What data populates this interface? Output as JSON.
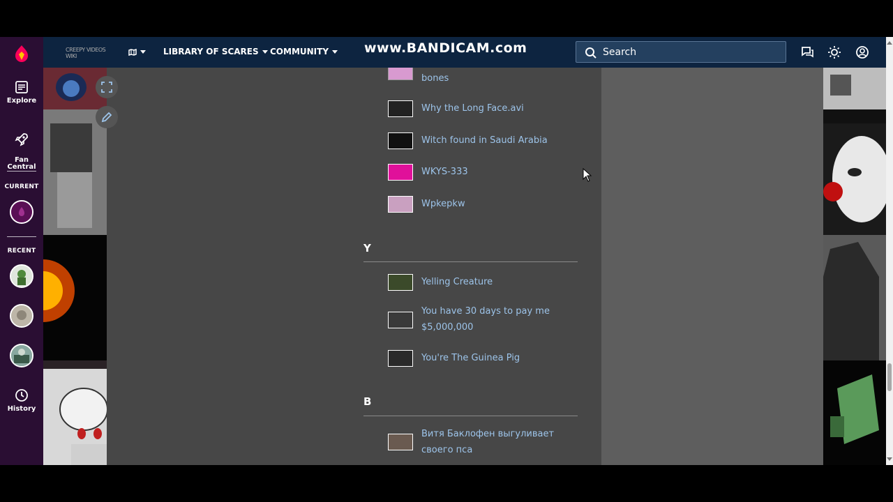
{
  "rail": {
    "explore": "Explore",
    "fan_central": "Fan\nCentral",
    "current": "CURRENT",
    "recent": "RECENT",
    "history": "History"
  },
  "nav": {
    "wiki_logo_text": "CREEPY VIDEOS WIKI",
    "library": "LIBRARY OF SCARES",
    "community": "COMMUNITY",
    "watermark": "www.BANDICAM.com",
    "search_placeholder": "Search"
  },
  "partial_entry": {
    "title": "bones"
  },
  "sections": [
    {
      "letter": "Y"
    },
    {
      "letter": "В"
    }
  ],
  "w_entries": [
    {
      "title": "Why the Long Face.avi",
      "thumb_color": "#222222"
    },
    {
      "title": "Witch found in Saudi Arabia",
      "thumb_color": "#111111"
    },
    {
      "title": "WKYS-333",
      "thumb_color": "#e0109a"
    },
    {
      "title": "Wpkepkw",
      "thumb_color": "#c9a0c0"
    }
  ],
  "y_entries": [
    {
      "title": "Yelling Creature",
      "thumb_color": "#3b4a2a"
    },
    {
      "title": "You have 30 days to pay me $5,000,000",
      "thumb_color": "#3a3a3a"
    },
    {
      "title": "You're The Guinea Pig",
      "thumb_color": "#2a2a2a"
    }
  ],
  "cyr_entries": [
    {
      "title": "Витя Баклофен выгуливает своего пса",
      "thumb_color": "#6a5a50"
    }
  ],
  "colors": {
    "link": "#9dc4ea",
    "topbar": "#0d2440",
    "rail": "#2a0e33",
    "background": "#474747"
  }
}
